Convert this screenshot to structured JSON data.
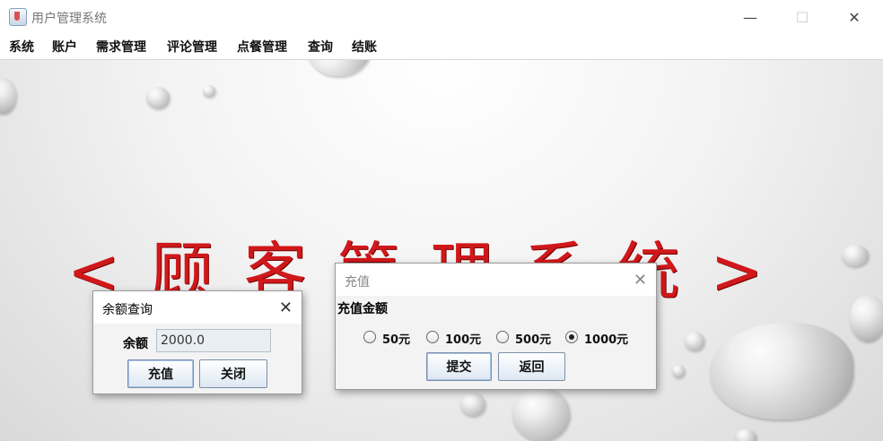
{
  "window": {
    "title": "用户管理系统",
    "minimize": "—",
    "maximize": "☐",
    "close": "✕"
  },
  "menu": [
    "系统",
    "账户",
    "需求管理",
    "评论管理",
    "点餐管理",
    "查询",
    "结账"
  ],
  "banner": {
    "text": "<顾客管理系统>"
  },
  "balance_dialog": {
    "title": "余额查询",
    "balance_label": "余额",
    "balance_value": "2000.0",
    "recharge_button": "充值",
    "close_button": "关闭"
  },
  "recharge_dialog": {
    "title": "充值",
    "amount_label": "充值金额",
    "options": [
      "50元",
      "100元",
      "500元",
      "1000元"
    ],
    "selected": "1000元",
    "submit_button": "提交",
    "back_button": "返回"
  },
  "colors": {
    "banner": "#d0181b",
    "button_border": "#7a8ea8"
  }
}
